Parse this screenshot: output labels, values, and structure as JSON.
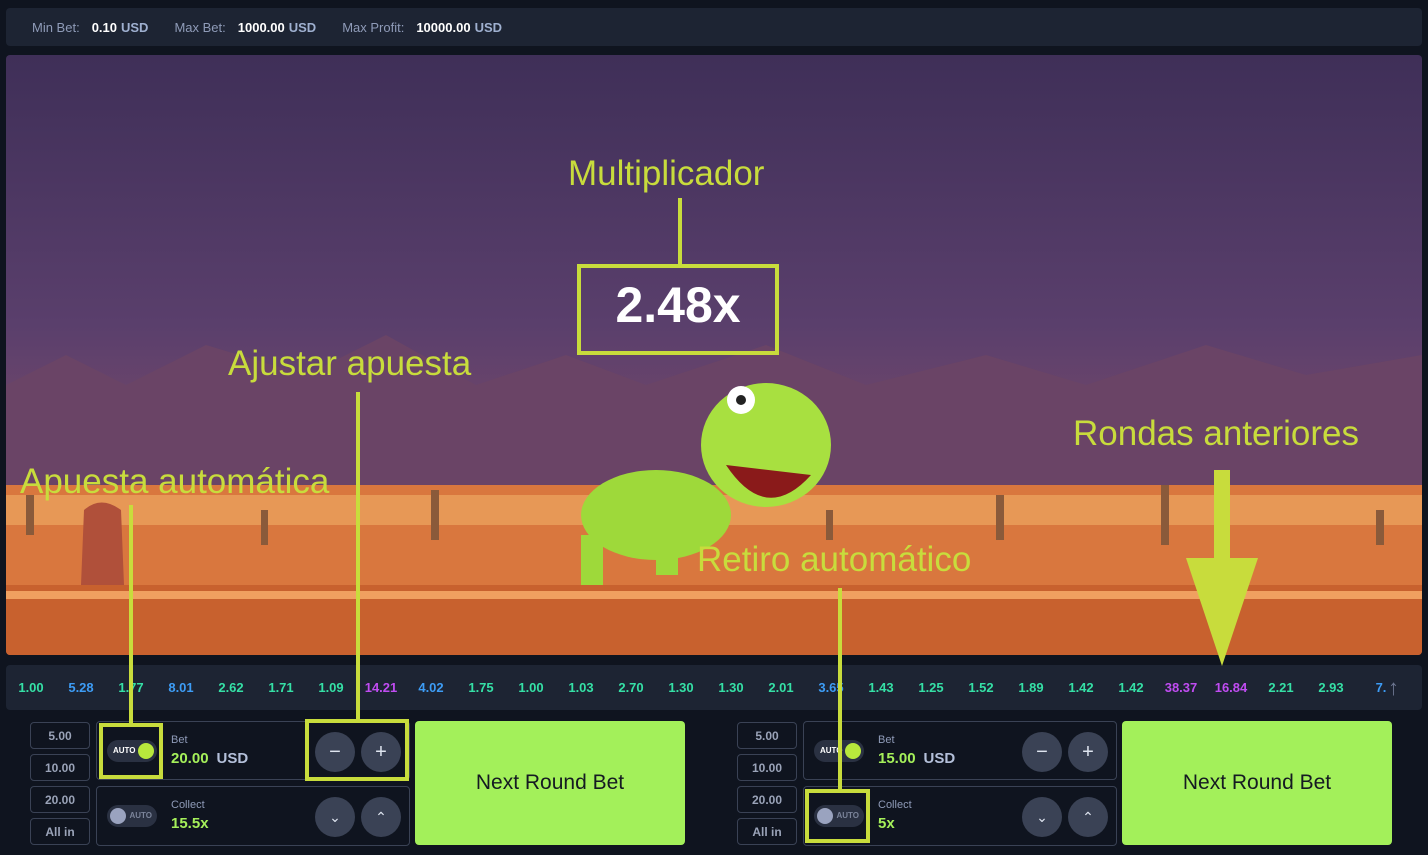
{
  "limits": {
    "min_bet_label": "Min Bet:",
    "min_bet_value": "0.10",
    "min_bet_unit": "USD",
    "max_bet_label": "Max Bet:",
    "max_bet_value": "1000.00",
    "max_bet_unit": "USD",
    "max_profit_label": "Max Profit:",
    "max_profit_value": "10000.00",
    "max_profit_unit": "USD"
  },
  "game": {
    "multiplier": "2.48x"
  },
  "history": [
    {
      "v": "1.00",
      "c": "#35e0a6"
    },
    {
      "v": "5.28",
      "c": "#3d9cf5"
    },
    {
      "v": "1.77",
      "c": "#35e0a6"
    },
    {
      "v": "8.01",
      "c": "#3d9cf5"
    },
    {
      "v": "2.62",
      "c": "#35e0a6"
    },
    {
      "v": "1.71",
      "c": "#35e0a6"
    },
    {
      "v": "1.09",
      "c": "#35e0a6"
    },
    {
      "v": "14.21",
      "c": "#c04cf2"
    },
    {
      "v": "4.02",
      "c": "#3d9cf5"
    },
    {
      "v": "1.75",
      "c": "#35e0a6"
    },
    {
      "v": "1.00",
      "c": "#35e0a6"
    },
    {
      "v": "1.03",
      "c": "#35e0a6"
    },
    {
      "v": "2.70",
      "c": "#35e0a6"
    },
    {
      "v": "1.30",
      "c": "#35e0a6"
    },
    {
      "v": "1.30",
      "c": "#35e0a6"
    },
    {
      "v": "2.01",
      "c": "#35e0a6"
    },
    {
      "v": "3.65",
      "c": "#3d9cf5"
    },
    {
      "v": "1.43",
      "c": "#35e0a6"
    },
    {
      "v": "1.25",
      "c": "#35e0a6"
    },
    {
      "v": "1.52",
      "c": "#35e0a6"
    },
    {
      "v": "1.89",
      "c": "#35e0a6"
    },
    {
      "v": "1.42",
      "c": "#35e0a6"
    },
    {
      "v": "1.42",
      "c": "#35e0a6"
    },
    {
      "v": "38.37",
      "c": "#c04cf2"
    },
    {
      "v": "16.84",
      "c": "#c04cf2"
    },
    {
      "v": "2.21",
      "c": "#35e0a6"
    },
    {
      "v": "2.93",
      "c": "#35e0a6"
    },
    {
      "v": "7.",
      "c": "#3d9cf5"
    }
  ],
  "panels": [
    {
      "presets": [
        "5.00",
        "10.00",
        "20.00",
        "All in"
      ],
      "auto_label": "AUTO",
      "bet_label": "Bet",
      "bet_value": "20.00",
      "bet_unit": "USD",
      "bet_auto_on": true,
      "collect_label": "Collect",
      "collect_value": "15.5x",
      "collect_auto_on": false,
      "minus": "−",
      "plus": "+",
      "down": "⌄",
      "up": "⌃",
      "button": "Next Round Bet"
    },
    {
      "presets": [
        "5.00",
        "10.00",
        "20.00",
        "All in"
      ],
      "auto_label": "AUTO",
      "bet_label": "Bet",
      "bet_value": "15.00",
      "bet_unit": "USD",
      "bet_auto_on": true,
      "collect_label": "Collect",
      "collect_value": "5x",
      "collect_auto_on": false,
      "minus": "−",
      "plus": "+",
      "down": "⌄",
      "up": "⌃",
      "button": "Next Round Bet"
    }
  ],
  "annotations": {
    "multiplier": "Multiplicador",
    "adjust_bet": "Ajustar apuesta",
    "auto_bet": "Apuesta automática",
    "auto_cashout": "Retiro automático",
    "previous_rounds": "Rondas anteriores"
  },
  "colors": {
    "accent": "#a3f05a",
    "annotation": "#c8dc3c",
    "low": "#35e0a6",
    "mid": "#3d9cf5",
    "high": "#c04cf2"
  }
}
